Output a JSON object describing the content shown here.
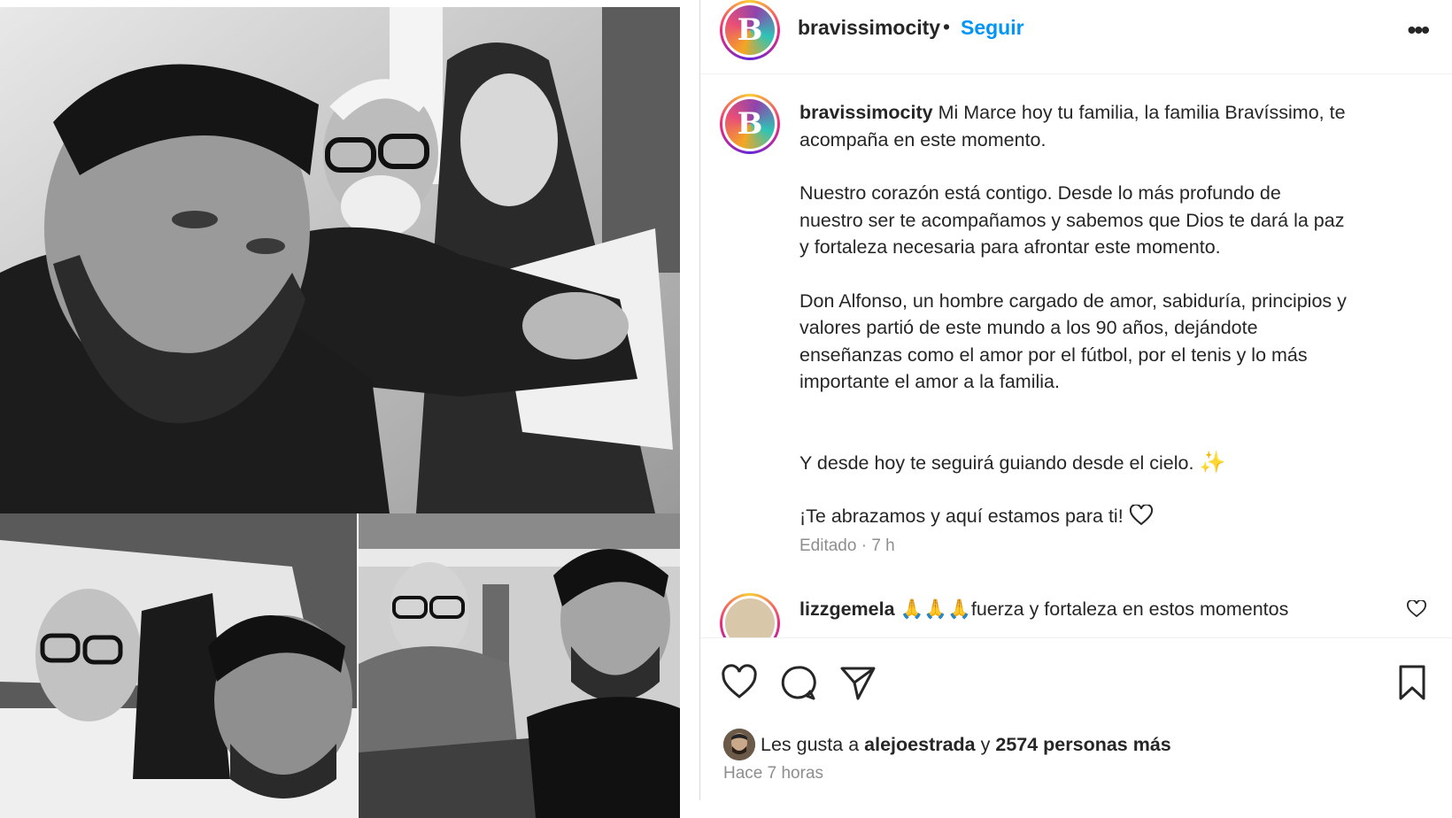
{
  "post": {
    "username": "bravissimocity",
    "follow_label": "Seguir",
    "avatar_letter": "B",
    "more_label": "•••",
    "caption": {
      "lines_p1": [
        "Mi Marce hoy tu familia, la familia Bravíssimo, te",
        "acompaña en este momento."
      ],
      "p2": [
        "Nuestro corazón está contigo. Desde lo más profundo de",
        "nuestro ser te acompañamos y sabemos que Dios te dará la paz",
        "y fortaleza necesaria para afrontar este momento."
      ],
      "p3": [
        "Don Alfonso, un hombre cargado de amor, sabiduría, principios y",
        "valores partió de este mundo a los 90 años, dejándote",
        "enseñanzas como el amor por el fútbol, por el tenis y lo más",
        "importante el amor a la familia."
      ],
      "p4": "Y desde hoy te seguirá guiando desde el cielo.",
      "p5": "¡Te abrazamos y aquí estamos para ti!",
      "sparkle": "✨"
    },
    "meta": "Editado · 7 h",
    "comment": {
      "username": "lizzgemela",
      "emojis": "🙏🙏🙏",
      "text": "fuerza y fortaleza en estos momentos"
    },
    "likes": {
      "prefix": "Les gusta a",
      "user": "alejoestrada",
      "conj": "y",
      "count_text": "2574 personas más"
    },
    "time_ago": "Hace 7 horas"
  },
  "icons": [
    "heart-icon",
    "comment-icon",
    "share-icon",
    "bookmark-icon",
    "more-icon"
  ],
  "colors": {
    "link": "#0095f6",
    "muted": "#8e8e8e",
    "text": "#262626"
  }
}
